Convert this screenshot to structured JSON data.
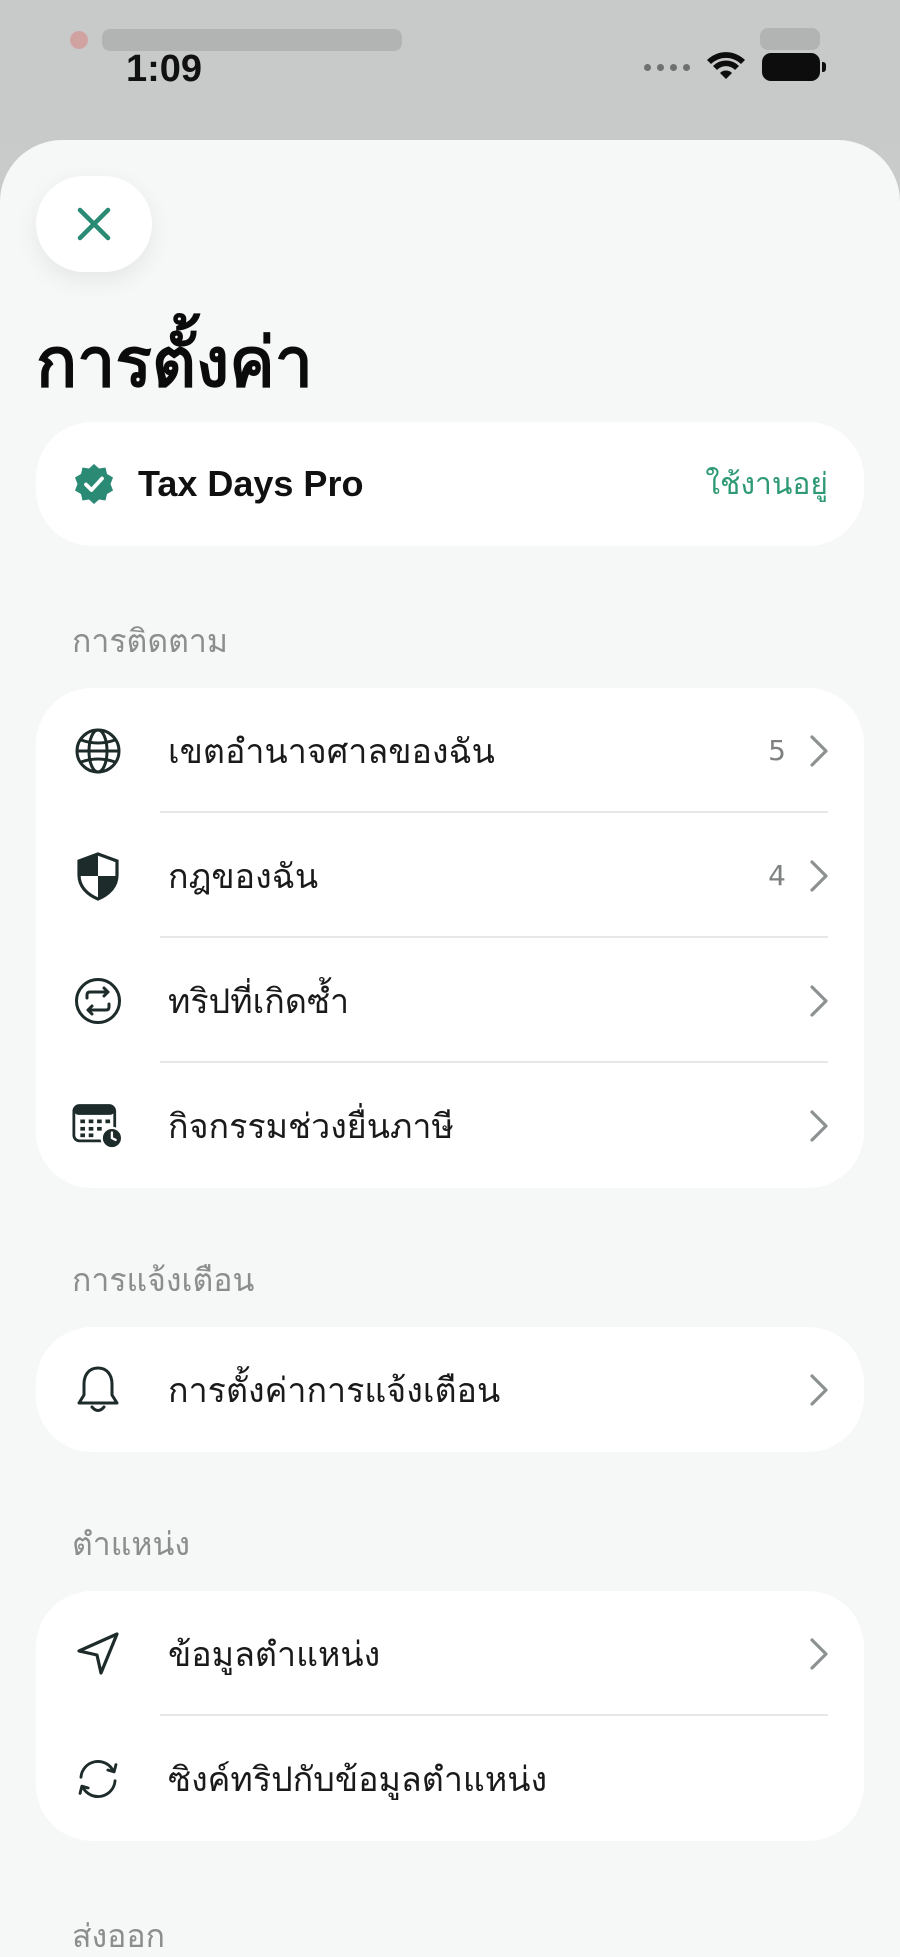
{
  "status_bar": {
    "time": "1:09"
  },
  "header": {
    "title": "การตั้งค่า"
  },
  "pro": {
    "name": "Tax Days Pro",
    "status": "ใช้งานอยู่",
    "accent_color": "#2e9a73",
    "icon": "verified-badge-icon"
  },
  "sections": {
    "tracking": {
      "label": "การติดตาม",
      "items": [
        {
          "label": "เขตอำนาจศาลของฉัน",
          "count": "5",
          "icon": "globe-icon"
        },
        {
          "label": "กฎของฉัน",
          "count": "4",
          "icon": "shield-icon"
        },
        {
          "label": "ทริปที่เกิดซ้ำ",
          "icon": "repeat-icon"
        },
        {
          "label": "กิจกรรมช่วงยื่นภาษี",
          "icon": "calendar-clock-icon"
        }
      ]
    },
    "notifications": {
      "label": "การแจ้งเตือน",
      "items": [
        {
          "label": "การตั้งค่าการแจ้งเตือน",
          "icon": "bell-icon"
        }
      ]
    },
    "location": {
      "label": "ตำแหน่ง",
      "items": [
        {
          "label": "ข้อมูลตำแหน่ง",
          "icon": "location-arrow-icon"
        },
        {
          "label": "ซิงค์ทริปกับข้อมูลตำแหน่ง",
          "icon": "sync-icon"
        }
      ]
    },
    "export": {
      "label": "ส่งออก"
    }
  },
  "colors": {
    "close_icon": "#2a8a74",
    "icon_dark": "#1d2b2a",
    "chevron": "#8e9191"
  }
}
